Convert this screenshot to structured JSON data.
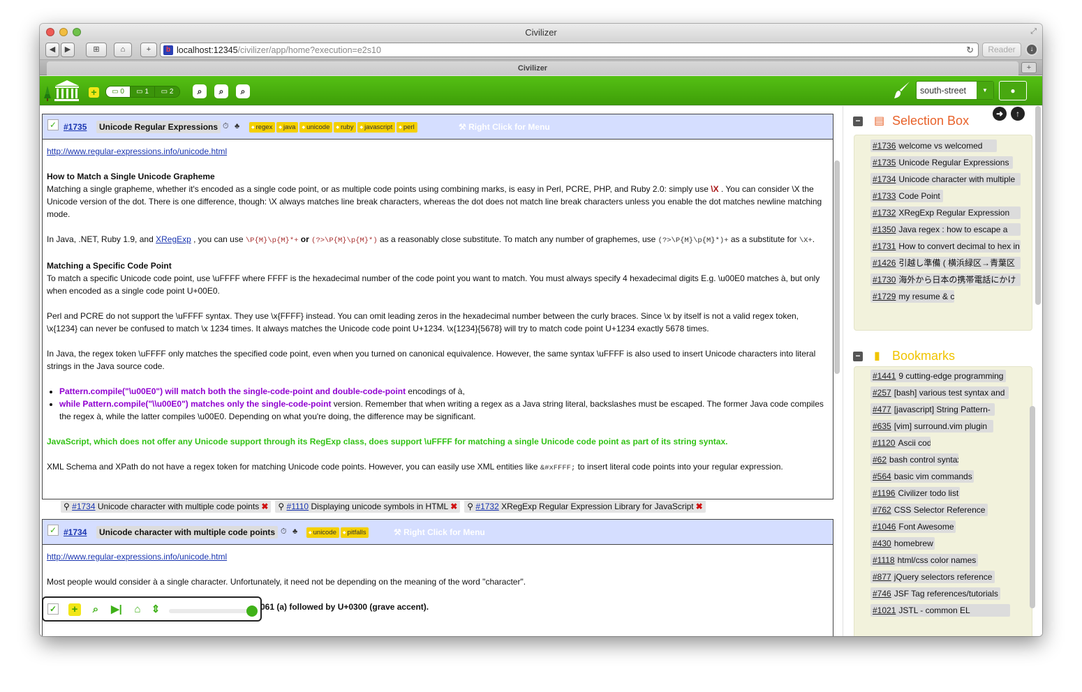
{
  "browser": {
    "window_title": "Civilizer",
    "url_host": "localhost:12345",
    "url_path": "/civilizer/app/home?execution=e2s10",
    "reader_label": "Reader",
    "tab_title": "Civilizer"
  },
  "appbar": {
    "workspaces": [
      "0",
      "1",
      "2"
    ],
    "theme_value": "south-street"
  },
  "cards": [
    {
      "id": "#1735",
      "title": "Unicode Regular Expressions",
      "tags": [
        "regex",
        "java",
        "unicode",
        "ruby",
        "javascript",
        "perl"
      ],
      "menu_hint": "Right Click for Menu",
      "url": "http://www.regular-expressions.info/unicode.html",
      "h1": "How to Match a Single Unicode Grapheme",
      "p1a": "Matching a single grapheme, whether it's encoded as a single code point, or as multiple code points using combining marks, is easy in Perl, PCRE, PHP, and Ruby 2.0: simply use ",
      "p1b": "\\X",
      "p1c": " . You can consider \\X the Unicode version of the dot. There is one difference, though: \\X always matches line break characters, whereas the dot does not match line break characters unless you enable the dot matches newline matching mode.",
      "p2a": "In Java, .NET, Ruby 1.9, and ",
      "p2_link": "XRegExp",
      "p2b": " , you can use ",
      "p2_code1": "\\P{M}\\p{M}*+",
      "p2_or": " or ",
      "p2_code2": "(?>\\P{M}\\p{M}*)",
      "p2c": " as a reasonably close substitute. To match any number of graphemes, use ",
      "p2_code3": "(?>\\P{M}\\p{M}*)+",
      "p2d": " as a substitute for ",
      "p2_code4": "\\X+",
      "p2e": ".",
      "h2": "Matching a Specific Code Point",
      "p3": "To match a specific Unicode code point, use \\uFFFF where FFFF is the hexadecimal number of the code point you want to match. You must always specify 4 hexadecimal digits E.g. \\u00E0 matches à, but only when encoded as a single code point U+00E0.",
      "p4": "Perl and PCRE do not support the \\uFFFF syntax. They use \\x{FFFF} instead. You can omit leading zeros in the hexadecimal number between the curly braces. Since \\x by itself is not a valid regex token, \\x{1234} can never be confused to match \\x 1234 times. It always matches the Unicode code point U+1234. \\x{1234}{5678} will try to match code point U+1234 exactly 5678 times.",
      "p5": "In Java, the regex token \\uFFFF only matches the specified code point, even when you turned on canonical equivalence. However, the same syntax \\uFFFF is also used to insert Unicode characters into literal strings in the Java source code.",
      "li1a": "Pattern.compile(\"\\u00E0\") will match both the single-code-point and double-code-point",
      "li1b": " encodings of à,",
      "li2a": "while Pattern.compile(\"\\\\u00E0\") matches only the single-code-point",
      "li2b": " version. Remember that when writing a regex as a Java string literal, backslashes must be escaped. The former Java code compiles the regex à, while the latter compiles \\u00E0. Depending on what you're doing, the difference may be significant.",
      "p6": "JavaScript, which does not offer any Unicode support through its RegExp class, does support \\uFFFF for matching a single Unicode code point as part of its string syntax.",
      "p7a": "XML Schema and XPath do not have a regex token for matching Unicode code points. However, you can easily use XML entities like ",
      "p7_code": "&#xFFFF;",
      "p7b": " to insert literal code points into your regular expression."
    },
    {
      "id": "#1734",
      "title": "Unicode character with multiple code points",
      "tags": [
        "unicode",
        "pitfalls"
      ],
      "menu_hint": "Right Click for Menu",
      "url": "http://www.regular-expressions.info/unicode.html",
      "p1": "Most people would consider à a single character. Unfortunately, it need not be depending on the meaning of the word \"character\".",
      "p2_visible": "061 (a) followed by U+0300 (grave accent)."
    }
  ],
  "related": [
    {
      "id": "#1734",
      "title": "Unicode character with multiple code points"
    },
    {
      "id": "#1110",
      "title": "Displaying unicode symbols in HTML"
    },
    {
      "id": "#1732",
      "title": "XRegExp Regular Expression Library for JavaScript"
    }
  ],
  "selection_box": {
    "title": "Selection Box",
    "items": [
      {
        "id": "#1736",
        "title": "welcome vs welcomed"
      },
      {
        "id": "#1735",
        "title": "Unicode Regular Expressions"
      },
      {
        "id": "#1734",
        "title": "Unicode character with multiple"
      },
      {
        "id": "#1733",
        "title": "Code Point"
      },
      {
        "id": "#1732",
        "title": "XRegExp Regular Expression"
      },
      {
        "id": "#1350",
        "title": "Java regex : how to escape a"
      },
      {
        "id": "#1731",
        "title": "How to convert decimal to hex in"
      },
      {
        "id": "#1426",
        "title": "引越し準備 ( 横浜緑区→青葉区"
      },
      {
        "id": "#1730",
        "title": "海外から日本の携帯電話にかけ"
      },
      {
        "id": "#1729",
        "title": "my resume & cv"
      }
    ]
  },
  "bookmarks": {
    "title": "Bookmarks",
    "items": [
      {
        "id": "#1441",
        "title": "9 cutting-edge programming"
      },
      {
        "id": "#257",
        "title": "[bash] various test syntax and"
      },
      {
        "id": "#477",
        "title": "[javascript] String Pattern-"
      },
      {
        "id": "#635",
        "title": "[vim] surround.vim plugin"
      },
      {
        "id": "#1120",
        "title": "Ascii code"
      },
      {
        "id": "#62",
        "title": "bash control syntax"
      },
      {
        "id": "#564",
        "title": "basic vim commands"
      },
      {
        "id": "#1196",
        "title": "Civilizer todo list"
      },
      {
        "id": "#762",
        "title": "CSS Selector Reference"
      },
      {
        "id": "#1046",
        "title": "Font Awesome"
      },
      {
        "id": "#430",
        "title": "homebrew"
      },
      {
        "id": "#1118",
        "title": "html/css color names"
      },
      {
        "id": "#877",
        "title": "jQuery selectors reference"
      },
      {
        "id": "#746",
        "title": "JSF Tag references/tutorials"
      },
      {
        "id": "#1021",
        "title": "JSTL - common EL"
      }
    ]
  },
  "colors": {
    "appbar_green": "#48a810",
    "card_header": "#d5deff",
    "tag_yellow": "#f4d000",
    "selection_title": "#e8622a",
    "bookmarks_title": "#f0c400",
    "purple_text": "#9000d0",
    "green_text": "#33c216"
  },
  "icons": [
    "museum-logo-icon",
    "add-icon",
    "search-icon",
    "brush-icon",
    "user-icon",
    "arrow-right-icon",
    "arrow-up-icon",
    "list-icon",
    "bookmark-icon",
    "check-icon",
    "skip-icon",
    "home-icon",
    "sort-icon",
    "link-icon",
    "delete-icon",
    "clock-icon",
    "tree-icon"
  ]
}
